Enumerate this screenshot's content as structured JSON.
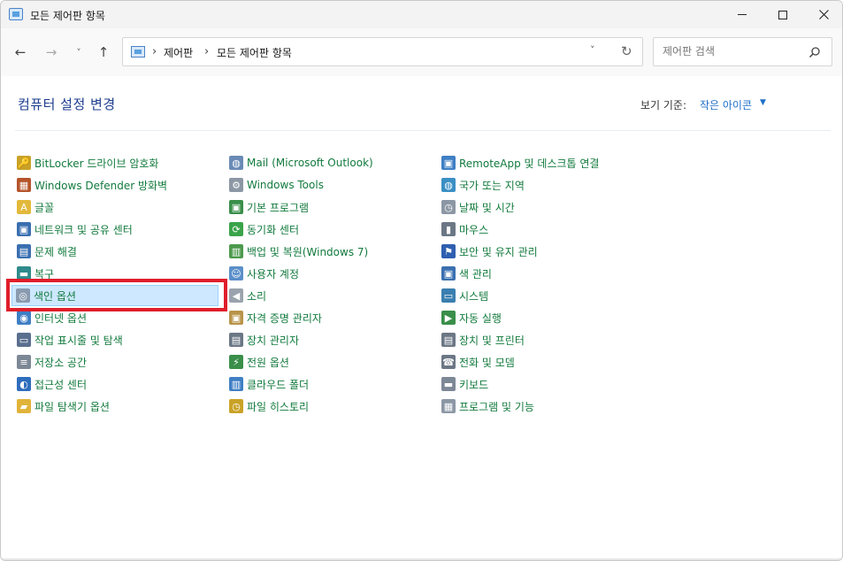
{
  "window": {
    "title": "모든 제어판 항목"
  },
  "navigation": {
    "back_icon": "←",
    "forward_icon": "→",
    "recent_icon": "˅",
    "up_icon": "↑",
    "breadcrumbs": [
      "제어판",
      "모든 제어판 항목"
    ],
    "separator": "›",
    "dropdown_icon": "˅",
    "refresh_icon": "↻"
  },
  "search": {
    "placeholder": "제어판 검색"
  },
  "header": {
    "title": "컴퓨터 설정 변경",
    "view_by_label": "보기 기준:",
    "view_by_value": "작은 아이콘",
    "view_by_caret": "▼"
  },
  "columns": [
    [
      {
        "label": "BitLocker 드라이브 암호화",
        "icon": "bitlocker-icon",
        "color": "#c9a227",
        "glyph": "🔑"
      },
      {
        "label": "Windows Defender 방화벽",
        "icon": "firewall-icon",
        "color": "#b5542b",
        "glyph": "▦"
      },
      {
        "label": "글꼴",
        "icon": "fonts-icon",
        "color": "#e2b93b",
        "glyph": "A"
      },
      {
        "label": "네트워크 및 공유 센터",
        "icon": "network-icon",
        "color": "#3a6fb0",
        "glyph": "▣"
      },
      {
        "label": "문제 해결",
        "icon": "troubleshoot-icon",
        "color": "#3a6fb0",
        "glyph": "▤"
      },
      {
        "label": "복구",
        "icon": "recovery-icon",
        "color": "#2e8b8b",
        "glyph": "▬"
      },
      {
        "label": "색인 옵션",
        "icon": "indexing-icon",
        "color": "#8a9bb0",
        "glyph": "◎"
      },
      {
        "label": "인터넷 옵션",
        "icon": "internet-options-icon",
        "color": "#3f7fc4",
        "glyph": "◉"
      },
      {
        "label": "작업 표시줄 및 탐색",
        "icon": "taskbar-icon",
        "color": "#5a6f8f",
        "glyph": "▭"
      },
      {
        "label": "저장소 공간",
        "icon": "storage-spaces-icon",
        "color": "#7d8896",
        "glyph": "≡"
      },
      {
        "label": "접근성 센터",
        "icon": "ease-of-access-icon",
        "color": "#2f6dbd",
        "glyph": "◐"
      },
      {
        "label": "파일 탐색기 옵션",
        "icon": "file-explorer-options-icon",
        "color": "#e0b43a",
        "glyph": "▰"
      }
    ],
    [
      {
        "label": "Mail (Microsoft Outlook)",
        "icon": "mail-icon",
        "color": "#6a8bb5",
        "glyph": "◍"
      },
      {
        "label": "Windows Tools",
        "icon": "windows-tools-icon",
        "color": "#8c97a5",
        "glyph": "⚙"
      },
      {
        "label": "기본 프로그램",
        "icon": "default-programs-icon",
        "color": "#3a8f4a",
        "glyph": "▣"
      },
      {
        "label": "동기화 센터",
        "icon": "sync-center-icon",
        "color": "#3aa34a",
        "glyph": "⟳"
      },
      {
        "label": "백업 및 복원(Windows 7)",
        "icon": "backup-restore-icon",
        "color": "#4d9a4d",
        "glyph": "▥"
      },
      {
        "label": "사용자 계정",
        "icon": "user-accounts-icon",
        "color": "#5b8fc9",
        "glyph": "☺"
      },
      {
        "label": "소리",
        "icon": "sound-icon",
        "color": "#9aa3ad",
        "glyph": "◀"
      },
      {
        "label": "자격 증명 관리자",
        "icon": "credential-manager-icon",
        "color": "#b8944a",
        "glyph": "▣"
      },
      {
        "label": "장치 관리자",
        "icon": "device-manager-icon",
        "color": "#6b7785",
        "glyph": "▤"
      },
      {
        "label": "전원 옵션",
        "icon": "power-options-icon",
        "color": "#3a8f4a",
        "glyph": "⚡"
      },
      {
        "label": "클라우드 폴더",
        "icon": "cloud-folder-icon",
        "color": "#3f7fc4",
        "glyph": "▥"
      },
      {
        "label": "파일 히스토리",
        "icon": "file-history-icon",
        "color": "#c9a227",
        "glyph": "◷"
      }
    ],
    [
      {
        "label": "RemoteApp 및 데스크톱 연결",
        "icon": "remoteapp-icon",
        "color": "#3f7fc4",
        "glyph": "▣"
      },
      {
        "label": "국가 또는 지역",
        "icon": "region-icon",
        "color": "#3a8fc4",
        "glyph": "◍"
      },
      {
        "label": "날짜 및 시간",
        "icon": "date-time-icon",
        "color": "#8c97a5",
        "glyph": "◷"
      },
      {
        "label": "마우스",
        "icon": "mouse-icon",
        "color": "#6b7785",
        "glyph": "▮"
      },
      {
        "label": "보안 및 유지 관리",
        "icon": "security-maintenance-icon",
        "color": "#2f5fb0",
        "glyph": "⚑"
      },
      {
        "label": "색 관리",
        "icon": "color-management-icon",
        "color": "#3a6fb0",
        "glyph": "▣"
      },
      {
        "label": "시스템",
        "icon": "system-icon",
        "color": "#3a7fb0",
        "glyph": "▭"
      },
      {
        "label": "자동 실행",
        "icon": "autoplay-icon",
        "color": "#3a8f4a",
        "glyph": "▶"
      },
      {
        "label": "장치 및 프린터",
        "icon": "devices-printers-icon",
        "color": "#6b7785",
        "glyph": "▤"
      },
      {
        "label": "전화 및 모뎀",
        "icon": "phone-modem-icon",
        "color": "#6b7785",
        "glyph": "☎"
      },
      {
        "label": "키보드",
        "icon": "keyboard-icon",
        "color": "#7d8896",
        "glyph": "▬"
      },
      {
        "label": "프로그램 및 기능",
        "icon": "programs-features-icon",
        "color": "#8c97a5",
        "glyph": "▦"
      }
    ]
  ],
  "selected_item": "색인 옵션"
}
